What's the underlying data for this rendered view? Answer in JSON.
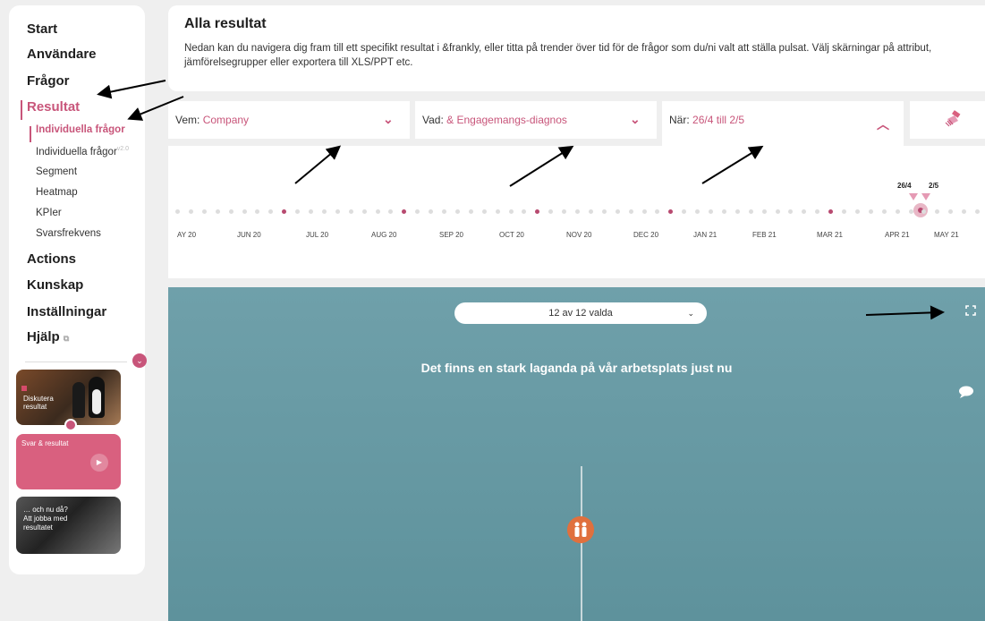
{
  "sidebar": {
    "items": [
      {
        "label": "Start"
      },
      {
        "label": "Användare"
      },
      {
        "label": "Frågor"
      },
      {
        "label": "Resultat"
      },
      {
        "label": "Actions"
      },
      {
        "label": "Kunskap"
      },
      {
        "label": "Inställningar"
      },
      {
        "label": "Hjälp"
      }
    ],
    "subitems": [
      {
        "label": "Individuella frågor"
      },
      {
        "label": "Individuella frågor",
        "sup": "v2.0"
      },
      {
        "label": "Segment"
      },
      {
        "label": "Heatmap"
      },
      {
        "label": "KPIer"
      },
      {
        "label": "Svarsfrekvens"
      }
    ],
    "cards": {
      "card1": "Diskutera resultat",
      "card2": "Svar & resultat",
      "card3": "… och nu då? Att jobba med resultatet"
    }
  },
  "header": {
    "title": "Alla resultat",
    "description": "Nedan kan du navigera dig fram till ett specifikt resultat i &frankly, eller titta på trender över tid för de frågor som du/ni valt att ställa pulsat. Välj skärningar på attribut, jämförelsegrupper eller exportera till XLS/PPT etc."
  },
  "filters": {
    "who": {
      "key": "Vem:",
      "value": "Company"
    },
    "what": {
      "key": "Vad:",
      "value": "& Engagemangs-diagnos"
    },
    "when": {
      "key": "När:",
      "value": "26/4 till 2/5"
    }
  },
  "timeline": {
    "months": [
      "AY 20",
      "JUN 20",
      "JUL 20",
      "AUG 20",
      "SEP 20",
      "OCT 20",
      "NOV 20",
      "DEC 20",
      "JAN 21",
      "FEB 21",
      "MAR 21",
      "APR 21",
      "MAY 21"
    ],
    "selected_start": "26/4",
    "selected_end": "2/5"
  },
  "content": {
    "selector": "12 av 12 valda",
    "statement": "Det finns en stark laganda på vår arbetsplats just nu"
  },
  "colors": {
    "accent": "#c8557a",
    "teal": "#6199a3"
  }
}
